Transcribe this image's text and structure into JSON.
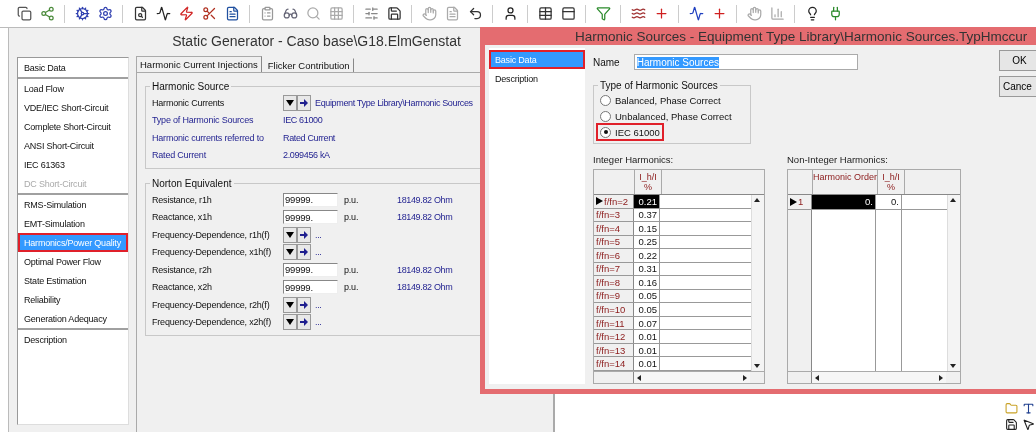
{
  "main_window": {
    "title": "Static Generator - Caso base\\G18.ElmGenstat",
    "sidebar": {
      "groups": [
        {
          "items": [
            {
              "label": "Basic Data",
              "selected": false,
              "disabled": false,
              "outlined": false
            }
          ]
        },
        {
          "items": [
            {
              "label": "Load Flow",
              "selected": false,
              "disabled": false,
              "outlined": false
            },
            {
              "label": "VDE/IEC Short-Circuit",
              "selected": false,
              "disabled": false,
              "outlined": false
            },
            {
              "label": "Complete Short-Circuit",
              "selected": false,
              "disabled": false,
              "outlined": false
            },
            {
              "label": "ANSI Short-Circuit",
              "selected": false,
              "disabled": false,
              "outlined": false
            },
            {
              "label": "IEC 61363",
              "selected": false,
              "disabled": false,
              "outlined": false
            },
            {
              "label": "DC Short-Circuit",
              "selected": false,
              "disabled": true,
              "outlined": false
            }
          ]
        },
        {
          "items": [
            {
              "label": "RMS-Simulation",
              "selected": false,
              "disabled": false,
              "outlined": false
            },
            {
              "label": "EMT-Simulation",
              "selected": false,
              "disabled": false,
              "outlined": false
            },
            {
              "label": "Harmonics/Power Quality",
              "selected": true,
              "disabled": false,
              "outlined": true
            },
            {
              "label": "Optimal Power Flow",
              "selected": false,
              "disabled": false,
              "outlined": false
            },
            {
              "label": "State Estimation",
              "selected": false,
              "disabled": false,
              "outlined": false
            },
            {
              "label": "Reliability",
              "selected": false,
              "disabled": false,
              "outlined": false
            },
            {
              "label": "Generation Adequacy",
              "selected": false,
              "disabled": false,
              "outlined": false
            }
          ]
        },
        {
          "items": [
            {
              "label": "Description",
              "selected": false,
              "disabled": false,
              "outlined": false
            }
          ]
        }
      ]
    },
    "tabs": [
      {
        "label": "Harmonic Current Injections",
        "selected": true
      },
      {
        "label": "Flicker Contribution",
        "selected": false
      }
    ],
    "groups": [
      {
        "title": "Harmonic Source",
        "rows": [
          {
            "kind": "select",
            "label": "Harmonic Currents",
            "value": "Equipment Type Library\\Harmonic Sources"
          },
          {
            "kind": "info",
            "label": "Type of Harmonic Sources",
            "value": "IEC 61000"
          },
          {
            "kind": "info",
            "label": "Harmonic currents referred to",
            "value": "Rated Current"
          },
          {
            "kind": "info",
            "label": "Rated Current",
            "value": "2.099456 kA"
          }
        ]
      },
      {
        "title": "Norton Equivalent",
        "rows": [
          {
            "kind": "input",
            "label": "Resistance, r1h",
            "value": "99999.",
            "unit": "p.u.",
            "result": "18149.82 Ohm"
          },
          {
            "kind": "input",
            "label": "Reactance, x1h",
            "value": "99999.",
            "unit": "p.u.",
            "result": "18149.82 Ohm"
          },
          {
            "kind": "select",
            "label": "Frequency-Dependence, r1h(f)",
            "value": "..."
          },
          {
            "kind": "select",
            "label": "Frequency-Dependence, x1h(f)",
            "value": "..."
          },
          {
            "kind": "input",
            "label": "Resistance, r2h",
            "value": "99999.",
            "unit": "p.u.",
            "result": "18149.82 Ohm"
          },
          {
            "kind": "input",
            "label": "Reactance, x2h",
            "value": "99999.",
            "unit": "p.u.",
            "result": "18149.82 Ohm"
          },
          {
            "kind": "select",
            "label": "Frequency-Dependence, r2h(f)",
            "value": "..."
          },
          {
            "kind": "select",
            "label": "Frequency-Dependence, x2h(f)",
            "value": "..."
          }
        ]
      }
    ]
  },
  "dialog": {
    "title": "Harmonic Sources - Equipment Type Library\\Harmonic Sources.TypHmccur",
    "sidebar": [
      {
        "label": "Basic Data",
        "selected": true,
        "outlined": true
      },
      {
        "label": "Description",
        "selected": false,
        "outlined": false
      }
    ],
    "name": {
      "label": "Name",
      "value": "Harmonic Sources",
      "highlighted": true
    },
    "type_group": {
      "title": "Type of Harmonic Sources",
      "options": [
        {
          "label": "Balanced, Phase Correct",
          "selected": false,
          "outlined": false
        },
        {
          "label": "Unbalanced, Phase Correct",
          "selected": false,
          "outlined": false
        },
        {
          "label": "IEC 61000",
          "selected": true,
          "outlined": true
        }
      ]
    },
    "buttons": [
      "OK",
      "Cance"
    ],
    "tables": [
      {
        "title": "Integer Harmonics:",
        "columns": [
          {
            "label": "I_h/I",
            "unit": "%"
          }
        ],
        "rows": [
          {
            "label": "f/fn=2",
            "current": true,
            "cells": [
              {
                "text": "0.21",
                "selected": true
              }
            ]
          },
          {
            "label": "f/fn=3",
            "current": false,
            "cells": [
              {
                "text": "0.37",
                "selected": false
              }
            ]
          },
          {
            "label": "f/fn=4",
            "current": false,
            "cells": [
              {
                "text": "0.15",
                "selected": false
              }
            ]
          },
          {
            "label": "f/fn=5",
            "current": false,
            "cells": [
              {
                "text": "0.25",
                "selected": false
              }
            ]
          },
          {
            "label": "f/fn=6",
            "current": false,
            "cells": [
              {
                "text": "0.22",
                "selected": false
              }
            ]
          },
          {
            "label": "f/fn=7",
            "current": false,
            "cells": [
              {
                "text": "0.31",
                "selected": false
              }
            ]
          },
          {
            "label": "f/fn=8",
            "current": false,
            "cells": [
              {
                "text": "0.16",
                "selected": false
              }
            ]
          },
          {
            "label": "f/fn=9",
            "current": false,
            "cells": [
              {
                "text": "0.05",
                "selected": false
              }
            ]
          },
          {
            "label": "f/fn=10",
            "current": false,
            "cells": [
              {
                "text": "0.05",
                "selected": false
              }
            ]
          },
          {
            "label": "f/fn=11",
            "current": false,
            "cells": [
              {
                "text": "0.07",
                "selected": false
              }
            ]
          },
          {
            "label": "f/fn=12",
            "current": false,
            "cells": [
              {
                "text": "0.01",
                "selected": false
              }
            ]
          },
          {
            "label": "f/fn=13",
            "current": false,
            "cells": [
              {
                "text": "0.01",
                "selected": false
              }
            ]
          },
          {
            "label": "f/fn=14",
            "current": false,
            "cells": [
              {
                "text": "0.01",
                "selected": false
              }
            ]
          }
        ]
      },
      {
        "title": "Non-Integer Harmonics:",
        "columns": [
          {
            "label": "Harmonic Order"
          },
          {
            "label": "I_h/I",
            "unit": "%"
          }
        ],
        "rows": [
          {
            "label": "1",
            "current": true,
            "cells": [
              {
                "text": "0.",
                "selected": true
              },
              {
                "text": "0.",
                "selected": false
              }
            ]
          }
        ]
      }
    ]
  }
}
